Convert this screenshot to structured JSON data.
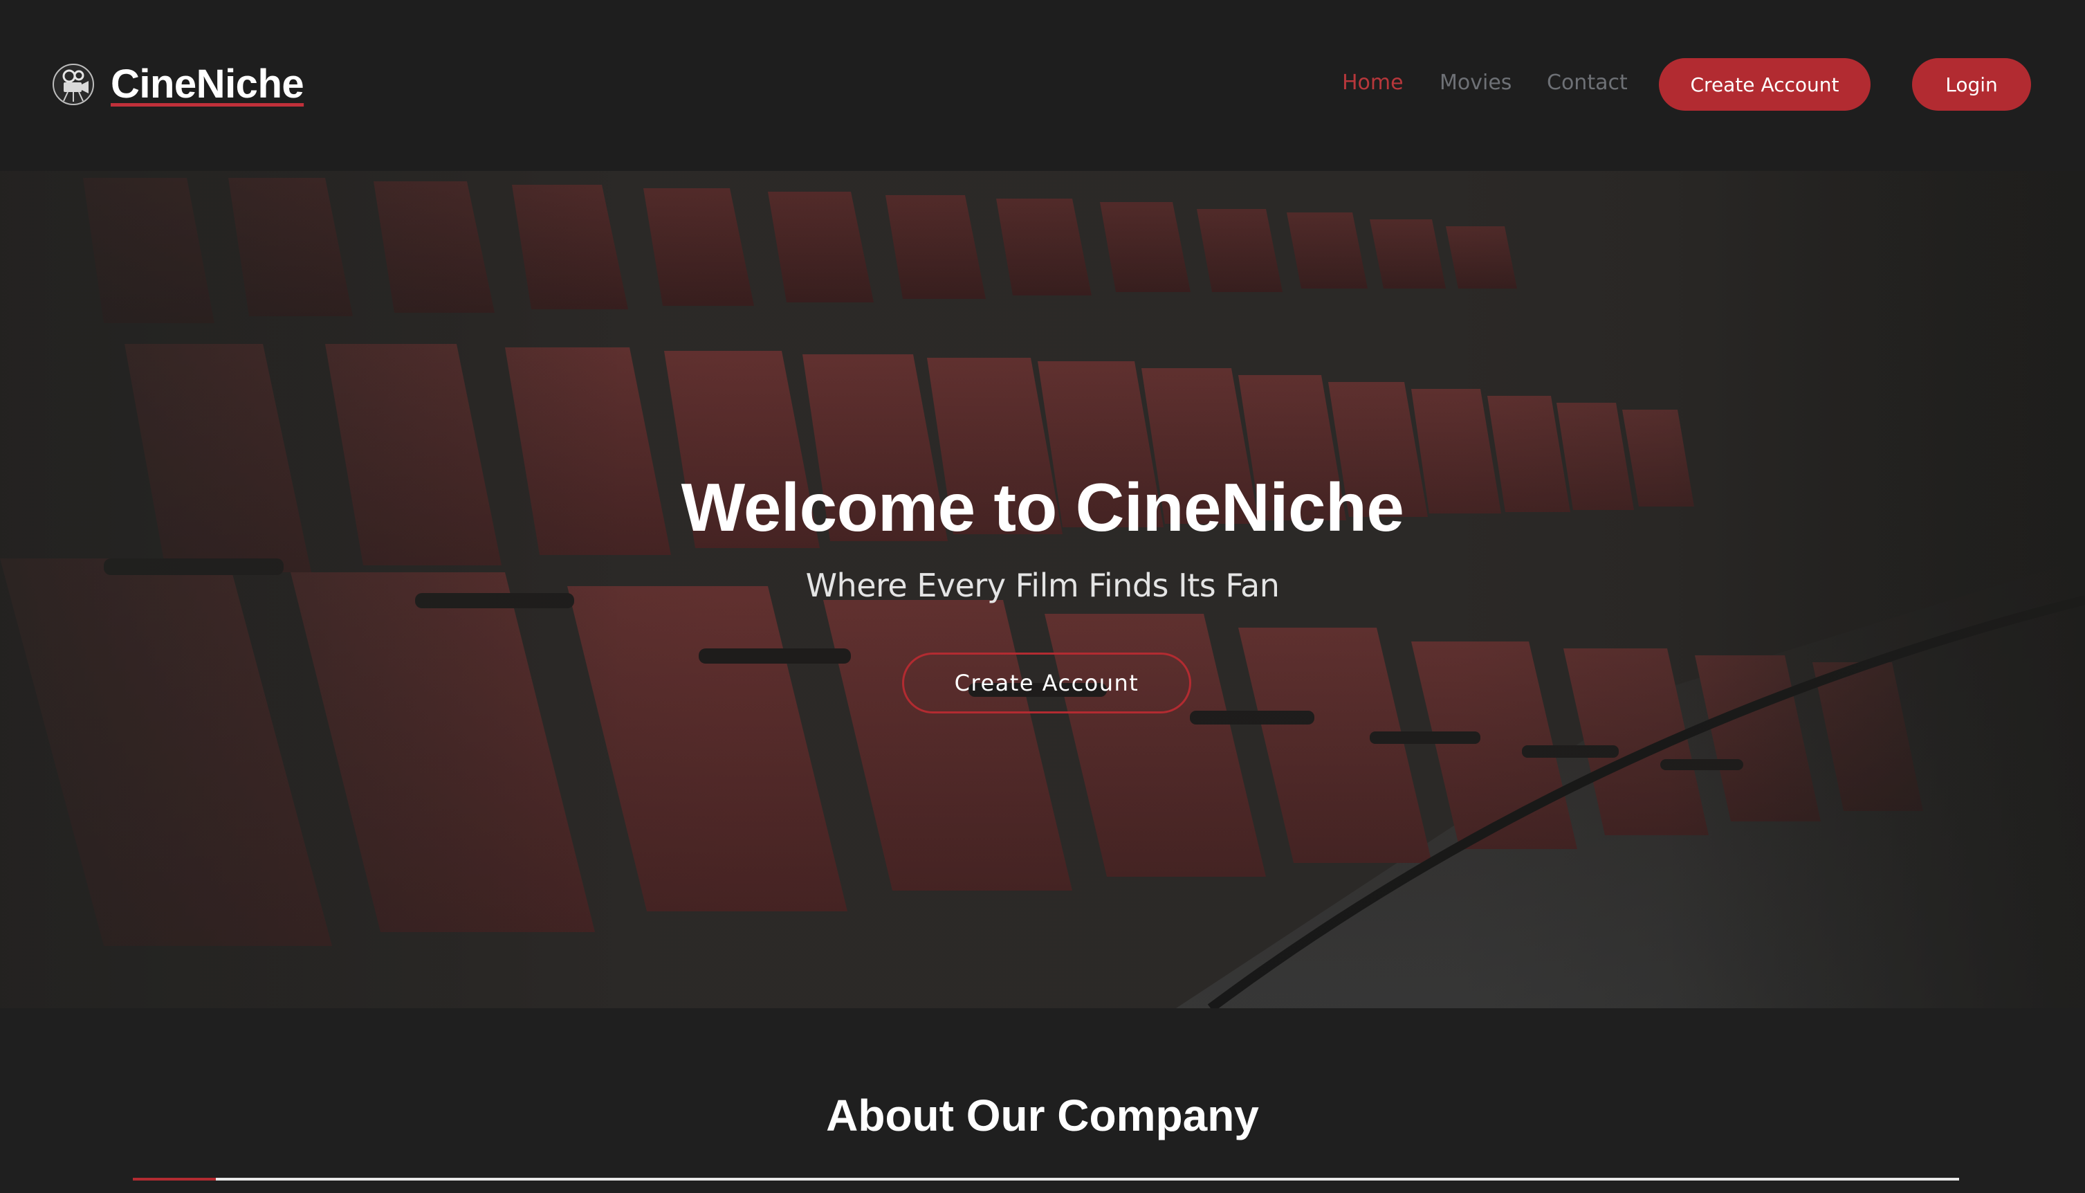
{
  "navbar": {
    "brand": "CineNiche",
    "logo_icon": "film-camera-icon",
    "links": [
      {
        "label": "Home",
        "active": true
      },
      {
        "label": "Movies",
        "active": false
      },
      {
        "label": "Contact",
        "active": false
      }
    ],
    "create_account_label": "Create Account",
    "login_label": "Login"
  },
  "hero": {
    "title": "Welcome to CineNiche",
    "subtitle": "Where Every Film Finds Its Fan",
    "cta_label": "Create Account",
    "background": "theater-seats-photo"
  },
  "about": {
    "title": "About Our Company"
  },
  "colors": {
    "accent": "#b22b31",
    "nav_active": "#b7373b",
    "nav_muted": "#6e7176",
    "background": "#1f1f1f"
  }
}
